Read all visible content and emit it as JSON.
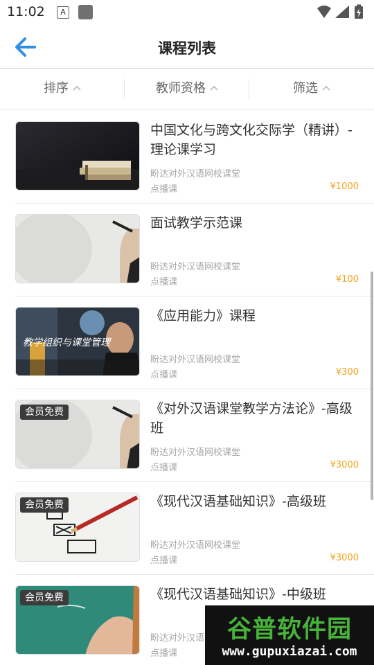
{
  "status_bar": {
    "time": "11:02",
    "a_icon": "A"
  },
  "header": {
    "title": "课程列表"
  },
  "filters": [
    {
      "label": "排序"
    },
    {
      "label": "教师资格"
    },
    {
      "label": "筛选"
    }
  ],
  "courses": [
    {
      "title": "中国文化与跨文化交际学（精讲）-理论课学习",
      "org": "盼达对外汉语网校课堂",
      "type": "点播课",
      "price": "¥1000",
      "badge": ""
    },
    {
      "title": "面试教学示范课",
      "org": "盼达对外汉语网校课堂",
      "type": "点播课",
      "price": "¥100",
      "badge": ""
    },
    {
      "title": "《应用能力》课程",
      "org": "盼达对外汉语网校课堂",
      "type": "点播课",
      "price": "¥300",
      "badge": "",
      "image_caption": "教学组织与课堂管理"
    },
    {
      "title": "《对外汉语课堂教学方法论》-高级班",
      "org": "盼达对外汉语网校课堂",
      "type": "点播课",
      "price": "¥3000",
      "badge": "会员免费"
    },
    {
      "title": "《现代汉语基础知识》-高级班",
      "org": "盼达对外汉语网校课堂",
      "type": "点播课",
      "price": "¥3000",
      "badge": "会员免费"
    },
    {
      "title": "《现代汉语基础知识》-中级班",
      "org": "盼达对外汉语网校课堂",
      "type": "点播课",
      "price": "",
      "badge": "会员免费"
    }
  ],
  "watermark": {
    "main": "谷普软件园",
    "url": "www.gupuxiazai.com"
  },
  "colors": {
    "accent": "#2f8ee5",
    "price": "#f3a21b",
    "badge_bg": "#3b3b3b"
  }
}
